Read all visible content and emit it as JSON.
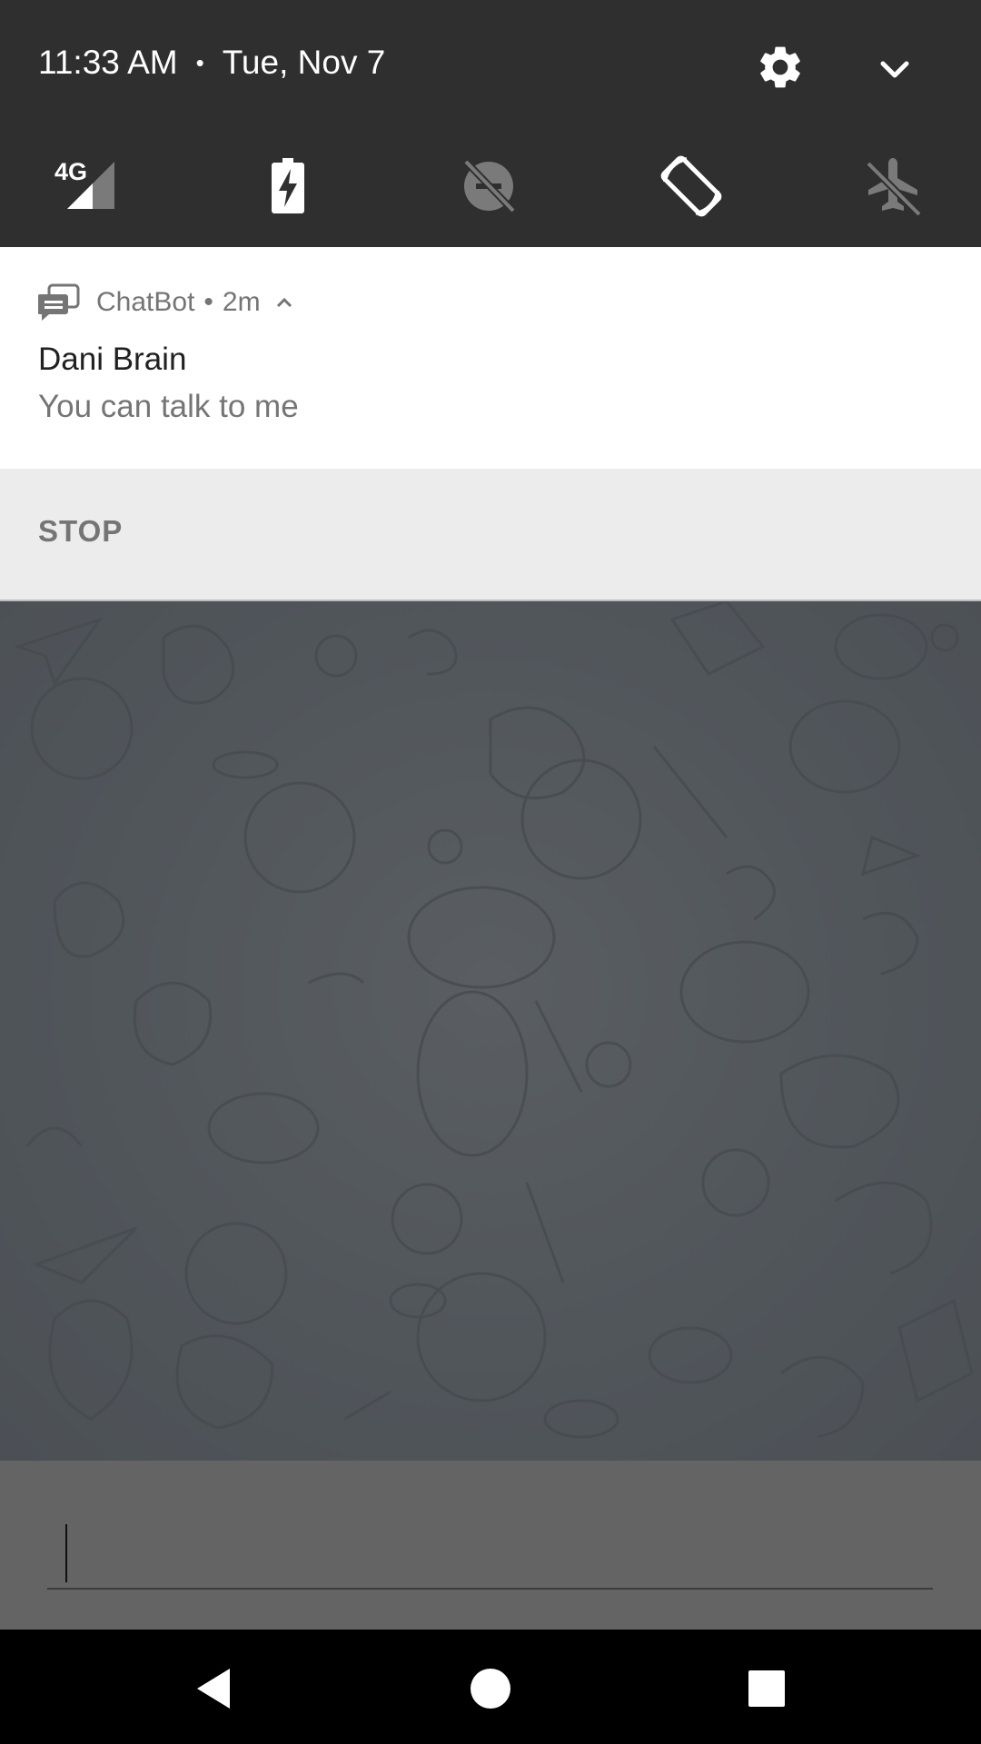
{
  "status": {
    "time": "11:33 AM",
    "separator": "•",
    "date": "Tue, Nov 7"
  },
  "quick_settings": {
    "tiles": [
      {
        "name": "mobile-data",
        "icon": "signal-4g-icon",
        "label": "4G"
      },
      {
        "name": "battery-saver",
        "icon": "battery-charging-icon"
      },
      {
        "name": "do-not-disturb",
        "icon": "dnd-off-icon"
      },
      {
        "name": "auto-rotate",
        "icon": "auto-rotate-icon"
      },
      {
        "name": "airplane-mode",
        "icon": "airplane-off-icon"
      }
    ],
    "colors": {
      "background": "#2f2f2f",
      "active": "#ffffff",
      "inactive": "#7a7a7a"
    }
  },
  "notification": {
    "app_name": "ChatBot",
    "separator": "•",
    "age": "2m",
    "title": "Dani Brain",
    "text": "You can talk to me",
    "action_label": "STOP"
  },
  "composer": {
    "value": ""
  },
  "navbar": {
    "buttons": [
      "back-icon",
      "home-icon",
      "recents-icon"
    ]
  }
}
